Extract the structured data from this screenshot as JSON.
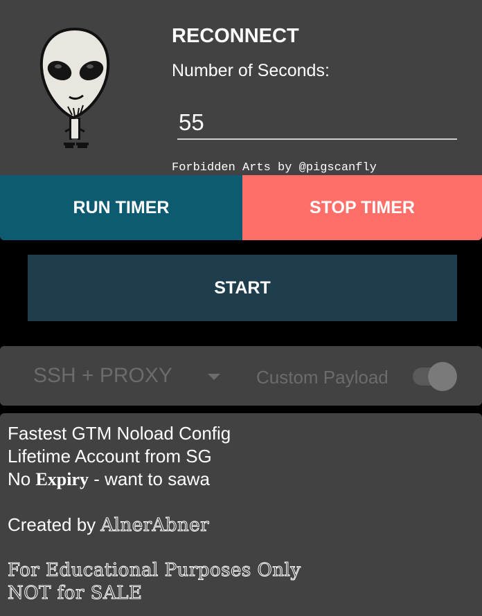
{
  "header": {
    "title": "RECONNECT",
    "seconds_label": "Number of Seconds:",
    "seconds_value": "55",
    "credit": "Forbidden Arts by @pigscanfly"
  },
  "buttons": {
    "run_timer": "RUN TIMER",
    "stop_timer": "STOP TIMER",
    "start": "START"
  },
  "options": {
    "mode": "SSH + PROXY",
    "custom_payload_label": "Custom Payload",
    "custom_payload_enabled": true
  },
  "info": {
    "line1": "Fastest GTM Noload Config",
    "line2": "Lifetime Account from SG",
    "line3_prefix": "No ",
    "line3_bold": "Expiry",
    "line3_suffix": " - want to sawa",
    "line4_prefix": "Created by ",
    "line4_author": "AlnerAbner",
    "line5": "For Educational Purposes Only",
    "line6": "NOT for SALE"
  },
  "colors": {
    "run_button": "#0d5b70",
    "stop_button": "#ff6f6a",
    "start_button": "#1e3d4d",
    "card_background": "#424242"
  },
  "icons": {
    "mascot": "alien-mascot-icon",
    "dropdown": "dropdown-arrow-icon"
  }
}
